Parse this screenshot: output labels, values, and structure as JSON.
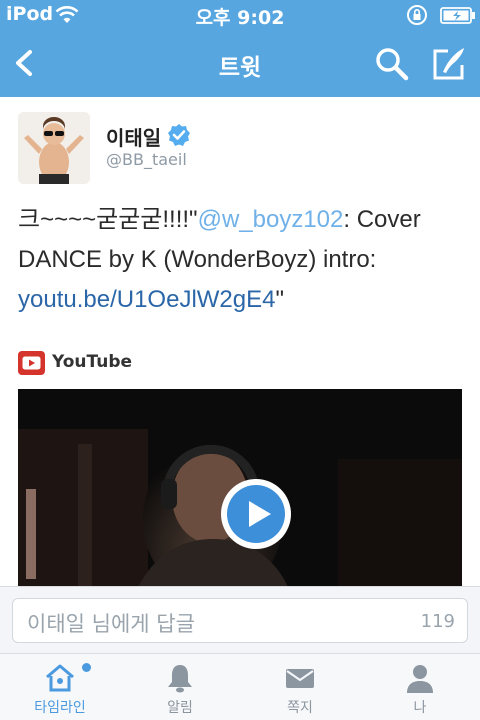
{
  "status_bar": {
    "carrier": "iPod",
    "time": "오후 9:02"
  },
  "nav": {
    "title": "트윗",
    "back_icon": "chevron-left-icon",
    "search_icon": "search-icon",
    "compose_icon": "compose-icon"
  },
  "tweet": {
    "user_name": "이태일",
    "handle": "@BB_taeil",
    "text_prefix": "크~~~~굳굳굳!!!!\"",
    "mention": "@w_boyz102",
    "text_middle": ": Cover DANCE by K (WonderBoyz) intro: ",
    "link": "youtu.be/U1OeJlW2gE4",
    "text_suffix": "\"",
    "media_source": "YouTube"
  },
  "reply": {
    "placeholder": "이태일 님에게 답글",
    "char_count": "119"
  },
  "tabs": [
    {
      "label": "타임라인",
      "icon": "home-icon",
      "active": true
    },
    {
      "label": "알림",
      "icon": "bell-icon",
      "active": false
    },
    {
      "label": "쪽지",
      "icon": "envelope-icon",
      "active": false
    },
    {
      "label": "나",
      "icon": "person-icon",
      "active": false
    }
  ],
  "colors": {
    "brand_blue": "#57a6e0",
    "mention": "#6fb1e8",
    "link": "#2b67a8",
    "youtube_red": "#d4342b"
  }
}
